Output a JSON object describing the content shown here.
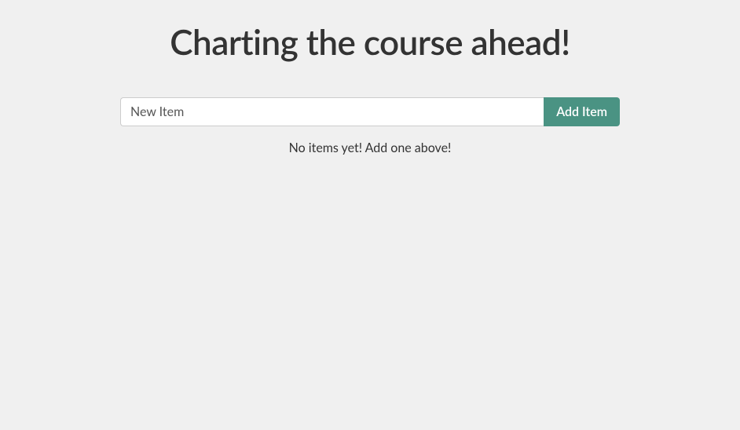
{
  "header": {
    "title": "Charting the course ahead!"
  },
  "form": {
    "input_placeholder": "New Item",
    "input_value": "",
    "add_button_label": "Add Item"
  },
  "list": {
    "empty_message": "No items yet! Add one above!",
    "items": []
  }
}
